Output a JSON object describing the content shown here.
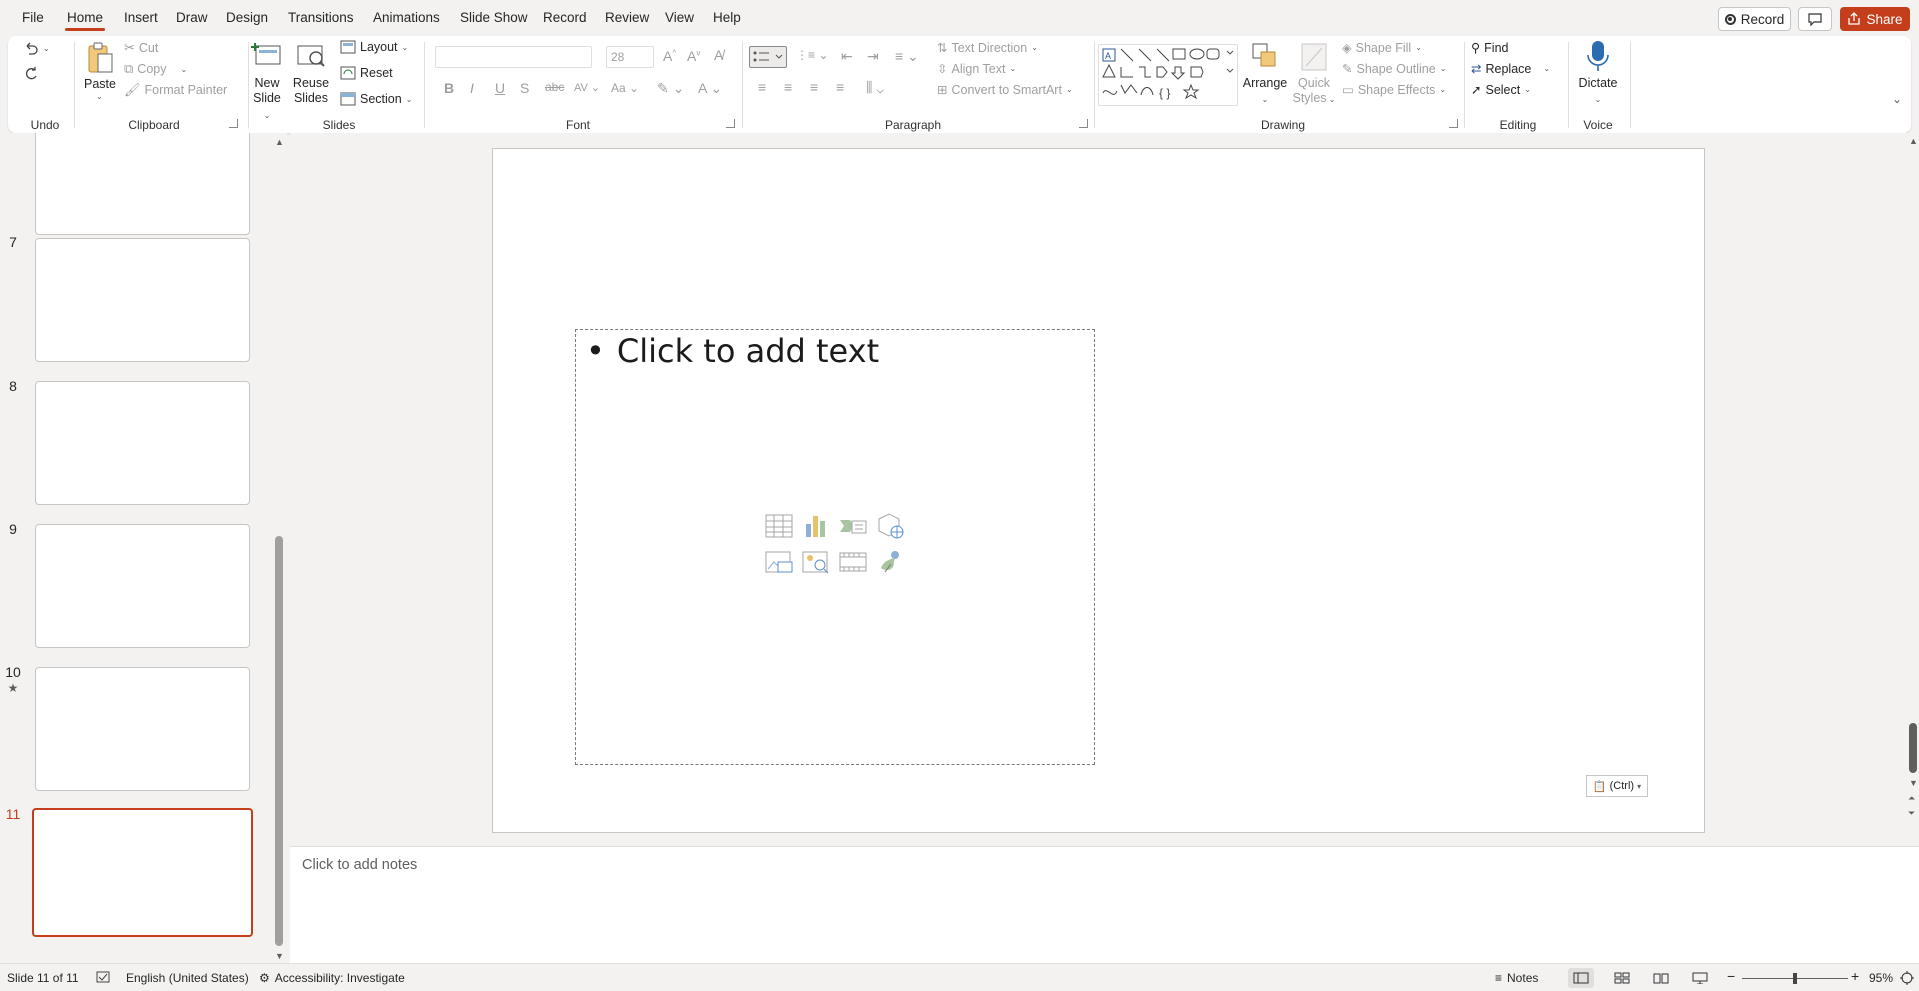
{
  "menu": {
    "tabs": [
      {
        "label": "File"
      },
      {
        "label": "Home"
      },
      {
        "label": "Insert"
      },
      {
        "label": "Draw"
      },
      {
        "label": "Design"
      },
      {
        "label": "Transitions"
      },
      {
        "label": "Animations"
      },
      {
        "label": "Slide Show"
      },
      {
        "label": "Record"
      },
      {
        "label": "Review"
      },
      {
        "label": "View"
      },
      {
        "label": "Help"
      }
    ],
    "active_tab": "Home",
    "record_label": "Record",
    "share_label": "Share"
  },
  "ribbon": {
    "undo": {
      "group_label": "Undo"
    },
    "clipboard": {
      "group_label": "Clipboard",
      "paste": "Paste",
      "cut": "Cut",
      "copy": "Copy",
      "format_painter": "Format Painter"
    },
    "slides": {
      "group_label": "Slides",
      "new_slide_1": "New",
      "new_slide_2": "Slide",
      "reuse_1": "Reuse",
      "reuse_2": "Slides",
      "layout": "Layout",
      "reset": "Reset",
      "section": "Section"
    },
    "font": {
      "group_label": "Font",
      "font_name": "",
      "font_size": "28"
    },
    "paragraph": {
      "group_label": "Paragraph",
      "text_direction": "Text Direction",
      "align_text": "Align Text",
      "convert_smartart": "Convert to SmartArt"
    },
    "drawing": {
      "group_label": "Drawing",
      "arrange": "Arrange",
      "quick_styles_1": "Quick",
      "quick_styles_2": "Styles",
      "shape_fill": "Shape Fill",
      "shape_outline": "Shape Outline",
      "shape_effects": "Shape Effects"
    },
    "editing": {
      "group_label": "Editing",
      "find": "Find",
      "replace": "Replace",
      "select": "Select"
    },
    "voice": {
      "group_label": "Voice",
      "dictate": "Dictate"
    }
  },
  "thumbnails": [
    {
      "number": "",
      "star": false,
      "selected": false
    },
    {
      "number": "7",
      "star": false,
      "selected": false
    },
    {
      "number": "8",
      "star": false,
      "selected": false
    },
    {
      "number": "9",
      "star": false,
      "selected": false
    },
    {
      "number": "10",
      "star": true,
      "selected": false
    },
    {
      "number": "11",
      "star": false,
      "selected": true
    }
  ],
  "slide": {
    "placeholder_text": "Click to add text",
    "bullet": "•",
    "paste_options": "(Ctrl)"
  },
  "notes": {
    "placeholder": "Click to add notes"
  },
  "status": {
    "slide_info": "Slide 11 of 11",
    "language": "English (United States)",
    "accessibility": "Accessibility: Investigate",
    "notes_label": "Notes",
    "zoom": "95%",
    "zoom_fraction": 0.5
  },
  "colors": {
    "accent": "#c43e1c",
    "background": "#f3f2f1"
  }
}
